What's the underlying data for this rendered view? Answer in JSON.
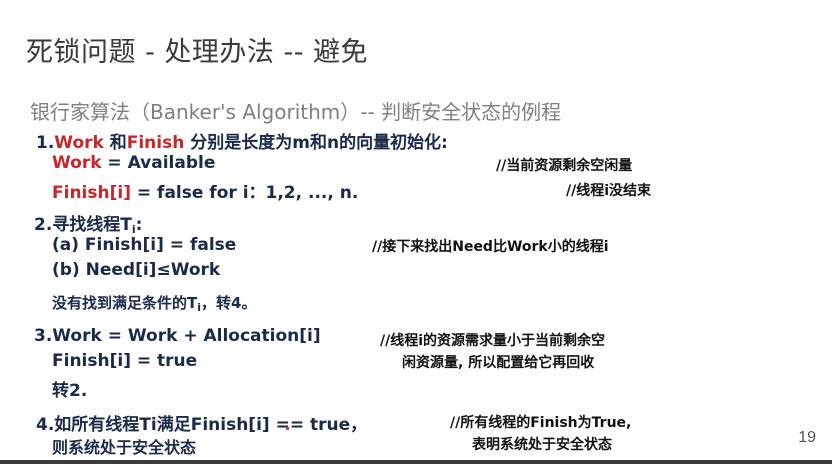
{
  "slide": {
    "title": "死锁问题 - 处理办法 -- 避免",
    "subtitle": "银行家算法（Banker's Algorithm）-- 判断安全状态的例程",
    "page_number": "19"
  },
  "step1": {
    "prefix": "1.",
    "work": "Work",
    "and": " 和",
    "finish": "Finish",
    "rest": " 分别是长度为m和n的向量初始化:",
    "line1_work": "Work",
    "line1_rest": " = Available",
    "line1_comment": "//当前资源剩余空闲量",
    "line2_finish": "Finish[i]",
    "line2_rest": " = false for i：1,2, ..., n.",
    "line2_comment": "//线程i没结束"
  },
  "step2": {
    "heading_text": "2.寻找线程T",
    "heading_sub": "i",
    "heading_colon": ":",
    "a": "(a) Finish[i] = false",
    "a_comment": "//接下来找出Need比Work小的线程i",
    "b": "(b) Need[i]≤Work",
    "none_text": "没有找到满足条件的T",
    "none_sub": "i",
    "none_end": "，转4。"
  },
  "step3": {
    "line1": "3.Work = Work + Allocation[i]",
    "line2": "Finish[i] = true",
    "line3": "转2.",
    "comment1": "//线程i的资源需求量小于当前剩余空",
    "comment2": "闲资源量, 所以配置给它再回收"
  },
  "step4": {
    "line1": "4.如所有线程Ti满足Finish[i] == true，",
    "line2": "则系统处于安全状态",
    "comment1": "//所有线程的Finish为True,",
    "comment2": "表明系统处于安全状态"
  }
}
